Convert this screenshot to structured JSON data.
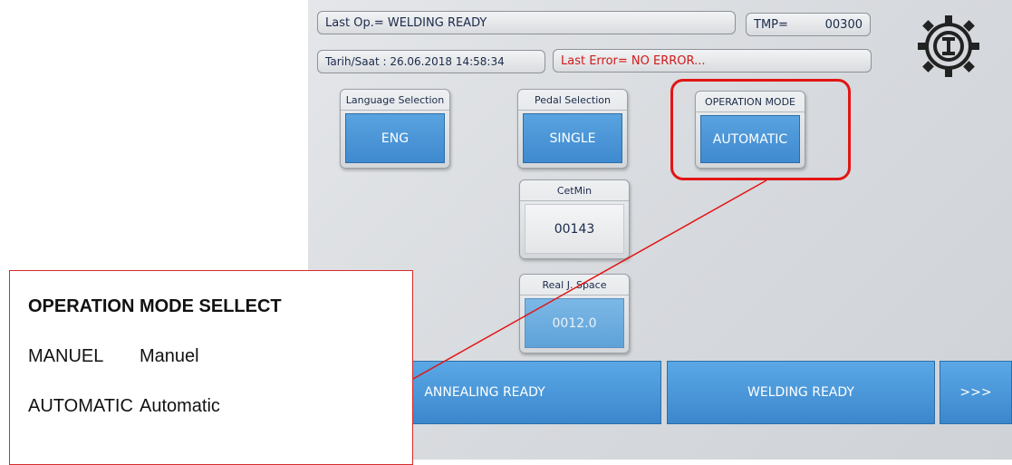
{
  "top_bar": {
    "last_op": "Last Op.= WELDING READY",
    "tmp_label": "TMP=",
    "tmp_value": "00300",
    "datetime": "Tarih/Saat : 26.06.2018 14:58:34",
    "last_error": "Last Error= NO ERROR..."
  },
  "tiles": {
    "language": {
      "label": "Language Selection",
      "value": "ENG"
    },
    "pedal": {
      "label": "Pedal Selection",
      "value": "SINGLE"
    },
    "operation_mode": {
      "label": "OPERATION MODE",
      "value": "AUTOMATIC"
    },
    "cetmin": {
      "label": "CetMin",
      "value": "00143"
    },
    "real_space": {
      "label": "Real J. Space",
      "value": "0012.0"
    }
  },
  "bottom": {
    "annealing": "ANNEALING READY",
    "welding": "WELDING READY",
    "next": ">>>"
  },
  "callout": {
    "title": "OPERATION MODE SELLECT",
    "rows": [
      {
        "key": "MANUEL",
        "desc": "Manuel"
      },
      {
        "key": "AUTOMATIC",
        "desc": "Automatic"
      }
    ]
  },
  "colors": {
    "button_blue": "#4a95d8",
    "highlight_red": "#e21515",
    "error_text": "#d01a1a"
  },
  "icons": {
    "logo": "company-gear-logo"
  }
}
